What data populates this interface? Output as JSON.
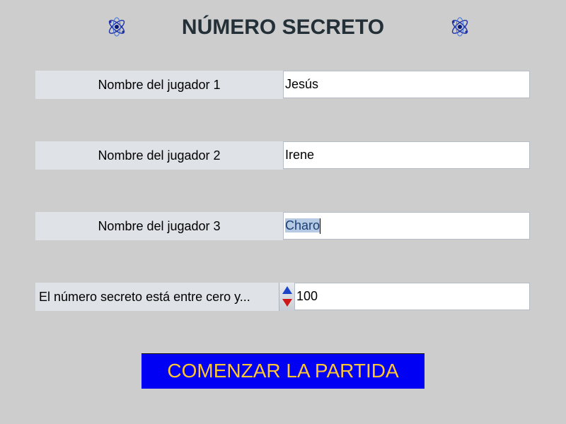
{
  "header": {
    "title": "NÚMERO SECRETO",
    "left_icon": "atom-icon",
    "right_icon": "atom-icon"
  },
  "players": [
    {
      "label": "Nombre del jugador 1",
      "value": "Jesús"
    },
    {
      "label": "Nombre del jugador 2",
      "value": "Irene"
    },
    {
      "label": "Nombre del jugador 3",
      "value": "Charo"
    }
  ],
  "range": {
    "label": "El número secreto está entre cero y...",
    "value": "100",
    "up_icon": "spinner-up-icon",
    "down_icon": "spinner-down-icon"
  },
  "start_button": {
    "label": "COMENZAR LA PARTIDA"
  },
  "colors": {
    "background": "#cdcdcd",
    "label_background": "#dfe2e7",
    "title_text": "#233038",
    "button_background": "#0000f5",
    "button_text": "#ffc62f",
    "selection": "#b6cbe3"
  }
}
